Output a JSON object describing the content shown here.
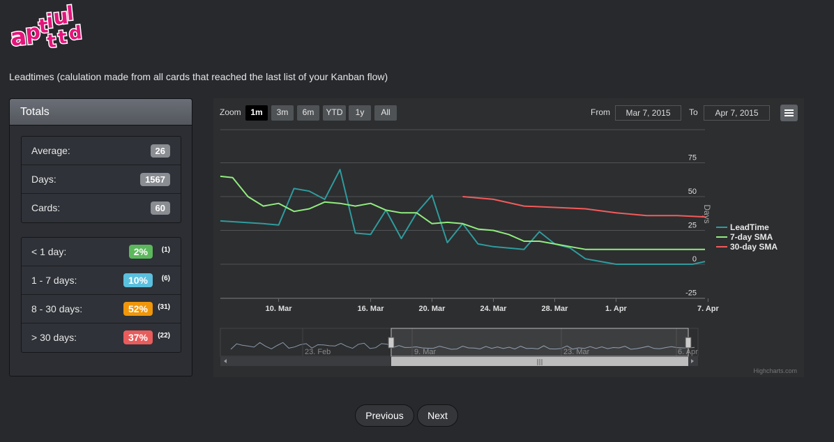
{
  "logo": {
    "text_top": "aptiul",
    "text_bottom": "ttd",
    "color": "#e4157a"
  },
  "page": {
    "subtitle": "Leadtimes (calulation made from all cards that reached the last list of your Kanban flow)"
  },
  "totals": {
    "title": "Totals",
    "stats": [
      {
        "label": "Average:",
        "value": "26"
      },
      {
        "label": "Days:",
        "value": "1567"
      },
      {
        "label": "Cards:",
        "value": "60"
      }
    ],
    "buckets": [
      {
        "label": "< 1 day:",
        "pct": "2%",
        "count": "(1)",
        "color": "#5cb85c"
      },
      {
        "label": "1 - 7 days:",
        "pct": "10%",
        "count": "(6)",
        "color": "#5bc0de"
      },
      {
        "label": "8 - 30 days:",
        "pct": "52%",
        "count": "(31)",
        "color": "#f0960a"
      },
      {
        "label": "> 30 days:",
        "pct": "37%",
        "count": "(22)",
        "color": "#e85c5c"
      }
    ]
  },
  "chart_toolbar": {
    "zoom_label": "Zoom",
    "buttons": [
      "1m",
      "3m",
      "6m",
      "YTD",
      "1y",
      "All"
    ],
    "active": "1m",
    "from_label": "From",
    "from_value": "Mar 7, 2015",
    "to_label": "To",
    "to_value": "Apr 7, 2015"
  },
  "chart_data": {
    "type": "line",
    "ylabel": "Days",
    "ylim": [
      -25,
      75
    ],
    "yticks": [
      "75",
      "50",
      "25",
      "0",
      "-25"
    ],
    "xticks": [
      {
        "label": "10. Mar",
        "day": 10
      },
      {
        "label": "16. Mar",
        "day": 16
      },
      {
        "label": "20. Mar",
        "day": 20
      },
      {
        "label": "24. Mar",
        "day": 24
      },
      {
        "label": "28. Mar",
        "day": 28
      },
      {
        "label": "1. Apr",
        "day": 32
      },
      {
        "label": "7. Apr",
        "day": 38
      }
    ],
    "series": [
      {
        "name": "LeadTime",
        "color": "#2e9c9e",
        "x": [
          6.2,
          9,
          10,
          11,
          12,
          13,
          14,
          15,
          16,
          17,
          18,
          19,
          20,
          21,
          22,
          23,
          24,
          25,
          26,
          27,
          28,
          29,
          30,
          31,
          32,
          33,
          34,
          35,
          36,
          37,
          37.8
        ],
        "y": [
          32,
          30,
          29,
          56,
          54,
          48,
          70,
          23,
          22,
          40,
          19,
          38,
          51,
          16,
          30,
          15,
          13,
          12,
          11,
          24,
          15,
          12,
          4,
          2,
          0,
          0,
          0,
          0,
          0,
          0,
          2
        ]
      },
      {
        "name": "7-day SMA",
        "color": "#90ee7e",
        "x": [
          6.2,
          7,
          8,
          9,
          10,
          11,
          12,
          13,
          14,
          15,
          16,
          17,
          18,
          19,
          20,
          21,
          22,
          23,
          24,
          25,
          26,
          27,
          28,
          29,
          30,
          31,
          32,
          33,
          34,
          35,
          36,
          37,
          37.8
        ],
        "y": [
          65,
          64,
          50,
          43,
          45,
          39,
          41,
          46,
          45,
          43,
          45,
          40,
          38,
          38,
          30,
          31,
          30,
          26,
          25,
          22,
          17,
          17,
          15,
          13,
          11,
          11,
          11,
          11,
          11,
          11,
          11,
          11,
          11
        ]
      },
      {
        "name": "30-day SMA",
        "color": "#f45b5b",
        "x": [
          22,
          24,
          26,
          28,
          30,
          32,
          34,
          36,
          37.8
        ],
        "y": [
          50,
          48,
          43,
          42,
          41,
          38,
          36,
          36,
          35
        ]
      }
    ],
    "navigator": {
      "ticks": [
        "23. Feb",
        "9. Mar",
        "23. Mar",
        "6. Apr"
      ]
    },
    "credits": "Highcharts.com"
  },
  "pager": {
    "previous": "Previous",
    "next": "Next"
  }
}
